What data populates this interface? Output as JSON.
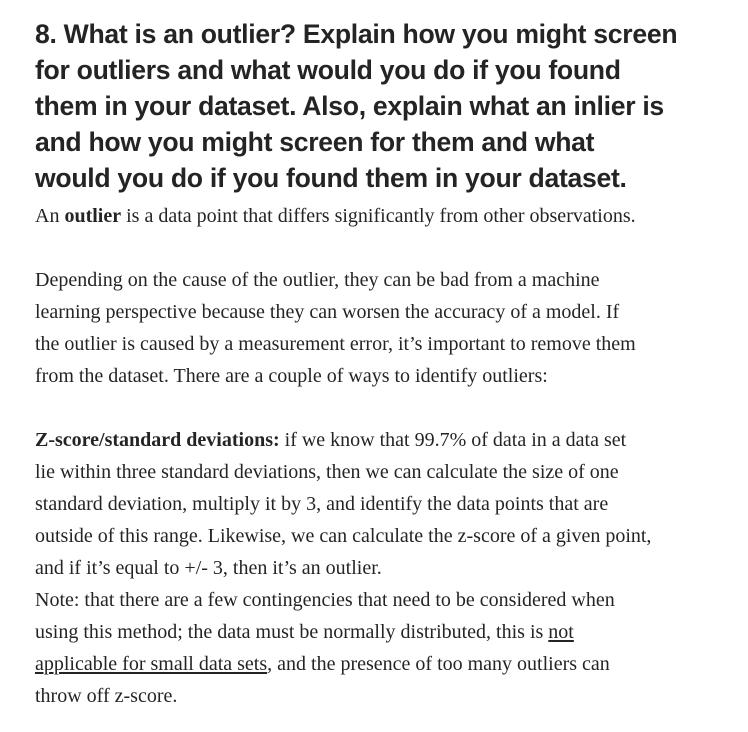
{
  "heading": {
    "lines": [
      "8. What is an outlier? Explain how you might screen",
      "for outliers and what would you do if you found",
      "them in your dataset. Also, explain what an inlier is",
      "and how you might screen for them and what",
      "would you do if you found them in your dataset."
    ]
  },
  "para1": {
    "pre": "An ",
    "bold": "outlier",
    "post": " is a data point that differs significantly from other observations."
  },
  "para2": {
    "lines": [
      "Depending on the cause of the outlier, they can be bad from a machine",
      "learning perspective because they can worsen the accuracy of a model. If",
      "the outlier is caused by a measurement error, it’s important to remove them",
      "from the dataset. There are a couple of ways to identify outliers:"
    ]
  },
  "para3": {
    "bold": "Z-score/standard deviations:",
    "line1_rest": " if we know that 99.7% of data in a data set",
    "lines": [
      "lie within three standard deviations, then we can calculate the size of one",
      "standard deviation, multiply it by 3, and identify the data points that are",
      "outside of this range. Likewise, we can calculate the z-score of a given point,",
      "and if it’s equal to +/- 3, then it’s an outlier."
    ]
  },
  "note": {
    "line1": "Note: that there are a few contingencies that need to be considered when",
    "line2_pre": "using this method; the data must be normally distributed, this is ",
    "link_part1": "not",
    "link_part2": "applicable for small data sets",
    "line3_post": ", and the presence of too many outliers can",
    "line4": "throw off z-score."
  }
}
